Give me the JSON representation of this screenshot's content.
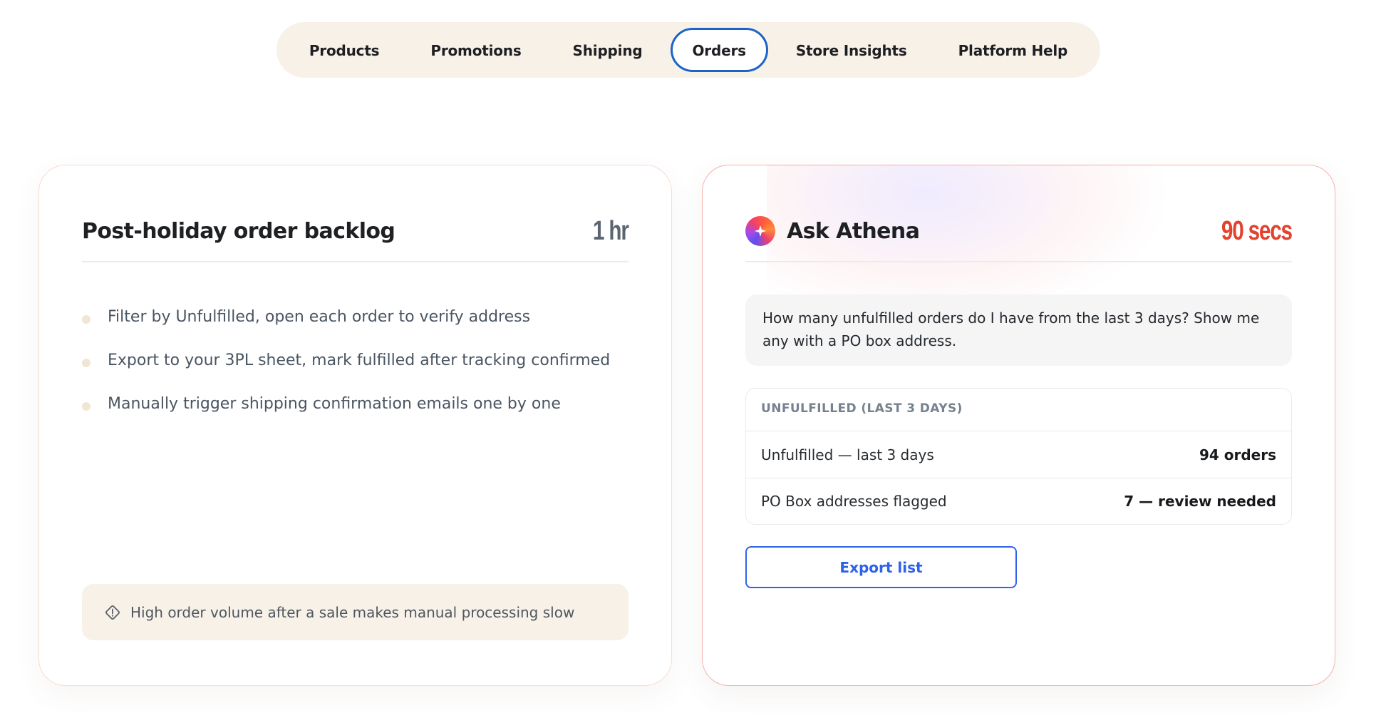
{
  "nav": {
    "items": [
      {
        "label": "Products",
        "active": false
      },
      {
        "label": "Promotions",
        "active": false
      },
      {
        "label": "Shipping",
        "active": false
      },
      {
        "label": "Orders",
        "active": true
      },
      {
        "label": "Store Insights",
        "active": false
      },
      {
        "label": "Platform Help",
        "active": false
      }
    ]
  },
  "manual_card": {
    "title": "Post-holiday order backlog",
    "time": "1 hr",
    "steps": [
      "Filter by Unfulfilled, open each order to verify address",
      "Export to your 3PL sheet, mark fulfilled after tracking confirmed",
      "Manually trigger shipping confirmation emails one by one"
    ],
    "note_icon": "warning-diamond-icon",
    "note": "High order volume after a sale makes manual processing slow"
  },
  "ai_card": {
    "logo_icon": "athena-star-icon",
    "title": "Ask Athena",
    "time": "90 secs",
    "prompt": "How many unfulfilled orders do I have from the last 3 days? Show me any with a PO box address.",
    "results": {
      "header": "UNFULFILLED (LAST 3 DAYS)",
      "rows": [
        {
          "label": "Unfulfilled — last 3 days",
          "value": "94 orders"
        },
        {
          "label": "PO Box addresses flagged",
          "value": "7 — review needed"
        }
      ]
    },
    "button_label": "Export list"
  },
  "colors": {
    "nav_bg": "#f8f1e8",
    "active_border": "#1a64c9",
    "ai_accent": "#e2432e",
    "button_blue": "#3163ea"
  }
}
